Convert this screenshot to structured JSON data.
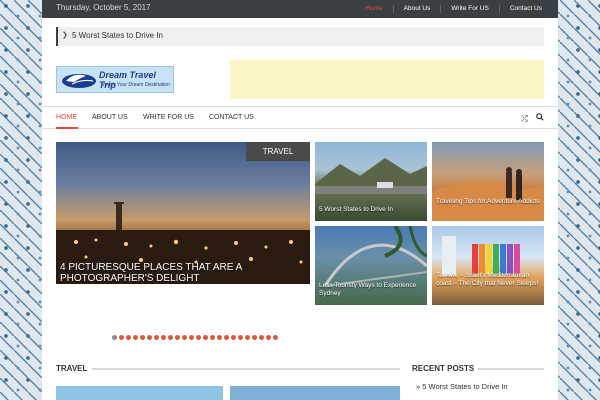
{
  "topbar": {
    "date": "Thursday, October 5, 2017",
    "links": [
      {
        "label": "Home",
        "active": true
      },
      {
        "label": "About Us",
        "active": false
      },
      {
        "label": "Write For US",
        "active": false
      },
      {
        "label": "Contact Us",
        "active": false
      }
    ]
  },
  "ticker": {
    "text": "5 Worst States to Drive In",
    "arrow_icon": "chevron-right-icon"
  },
  "logo": {
    "title": "Dream Travel Trip",
    "tagline": "Reach Your Dream Destination"
  },
  "nav": {
    "items": [
      "HOME",
      "ABOUT US",
      "WRITE FOR US",
      "CONTACT US"
    ],
    "icons": [
      "shuffle-icon",
      "search-icon"
    ]
  },
  "featured": {
    "main": {
      "badge": "TRAVEL",
      "title": "4 PICTURESQUE PLACES THAT ARE A PHOTOGRAPHER'S DELIGHT"
    },
    "grid": [
      {
        "title": "5 Worst States to Drive In"
      },
      {
        "title": "Traveling Tips for Adventure Addicts"
      },
      {
        "title": "Less Touristy Ways to Experience Sydney"
      },
      {
        "title": "Tel Aviv – Israel's Mediterranean coast – The City that Never Sleeps!"
      }
    ],
    "slider_dot_count": 24,
    "slider_active_index": 0
  },
  "sections": {
    "travel": "TRAVEL",
    "recent_posts": "RECENT POSTS",
    "recent_items": [
      "5 Worst States to Drive In"
    ]
  },
  "colors": {
    "accent": "#e54a3c",
    "topbar": "#3a3f44",
    "ad": "#fcf6c6"
  }
}
